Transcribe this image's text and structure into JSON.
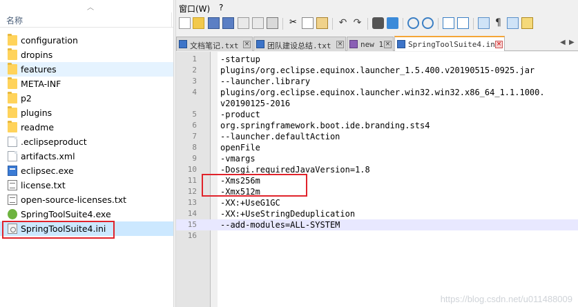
{
  "explorer": {
    "column_header": "名称",
    "items": [
      {
        "name": "configuration",
        "type": "folder"
      },
      {
        "name": "dropins",
        "type": "folder"
      },
      {
        "name": "features",
        "type": "folder"
      },
      {
        "name": "META-INF",
        "type": "folder"
      },
      {
        "name": "p2",
        "type": "folder"
      },
      {
        "name": "plugins",
        "type": "folder"
      },
      {
        "name": "readme",
        "type": "folder"
      },
      {
        "name": ".eclipseproduct",
        "type": "file"
      },
      {
        "name": "artifacts.xml",
        "type": "file"
      },
      {
        "name": "eclipsec.exe",
        "type": "exe"
      },
      {
        "name": "license.txt",
        "type": "txt"
      },
      {
        "name": "open-source-licenses.txt",
        "type": "txt"
      },
      {
        "name": "SpringToolSuite4.exe",
        "type": "sts"
      },
      {
        "name": "SpringToolSuite4.ini",
        "type": "ini"
      }
    ],
    "icons": {
      "folder": "folder-icon",
      "file": "file-icon",
      "exe": "exe-icon",
      "txt": "text-file-icon",
      "sts": "spring-icon",
      "ini": "settings-file-icon"
    }
  },
  "notepad": {
    "menu": {
      "window": "窗口(W)",
      "help": "?"
    },
    "tabs": [
      {
        "label": "文档笔记.txt"
      },
      {
        "label": "团队建设总结.txt"
      },
      {
        "label": "new 1"
      },
      {
        "label": "SpringToolSuite4.ini"
      }
    ],
    "lines": [
      {
        "n": "1",
        "text": "-startup"
      },
      {
        "n": "2",
        "text": "plugins/org.eclipse.equinox.launcher_1.5.400.v20190515-0925.jar"
      },
      {
        "n": "3",
        "text": "--launcher.library"
      },
      {
        "n": "4",
        "text": "plugins/org.eclipse.equinox.launcher.win32.win32.x86_64_1.1.1000."
      },
      {
        "n": "",
        "text": "v20190125-2016"
      },
      {
        "n": "5",
        "text": "-product"
      },
      {
        "n": "6",
        "text": "org.springframework.boot.ide.branding.sts4"
      },
      {
        "n": "7",
        "text": "--launcher.defaultAction"
      },
      {
        "n": "8",
        "text": "openFile"
      },
      {
        "n": "9",
        "text": "-vmargs"
      },
      {
        "n": "10",
        "text": "-Dosgi.requiredJavaVersion=1.8"
      },
      {
        "n": "11",
        "text": "-Xms256m"
      },
      {
        "n": "12",
        "text": "-Xmx512m"
      },
      {
        "n": "13",
        "text": "-XX:+UseG1GC"
      },
      {
        "n": "14",
        "text": "-XX:+UseStringDeduplication"
      },
      {
        "n": "15",
        "text": "--add-modules=ALL-SYSTEM"
      },
      {
        "n": "16",
        "text": ""
      }
    ],
    "watermark": "https://blog.csdn.net/u011488009"
  },
  "colors": {
    "highlight_box": "#e0222a",
    "selected_row": "#cce8ff",
    "current_line": "#e8e8ff"
  }
}
